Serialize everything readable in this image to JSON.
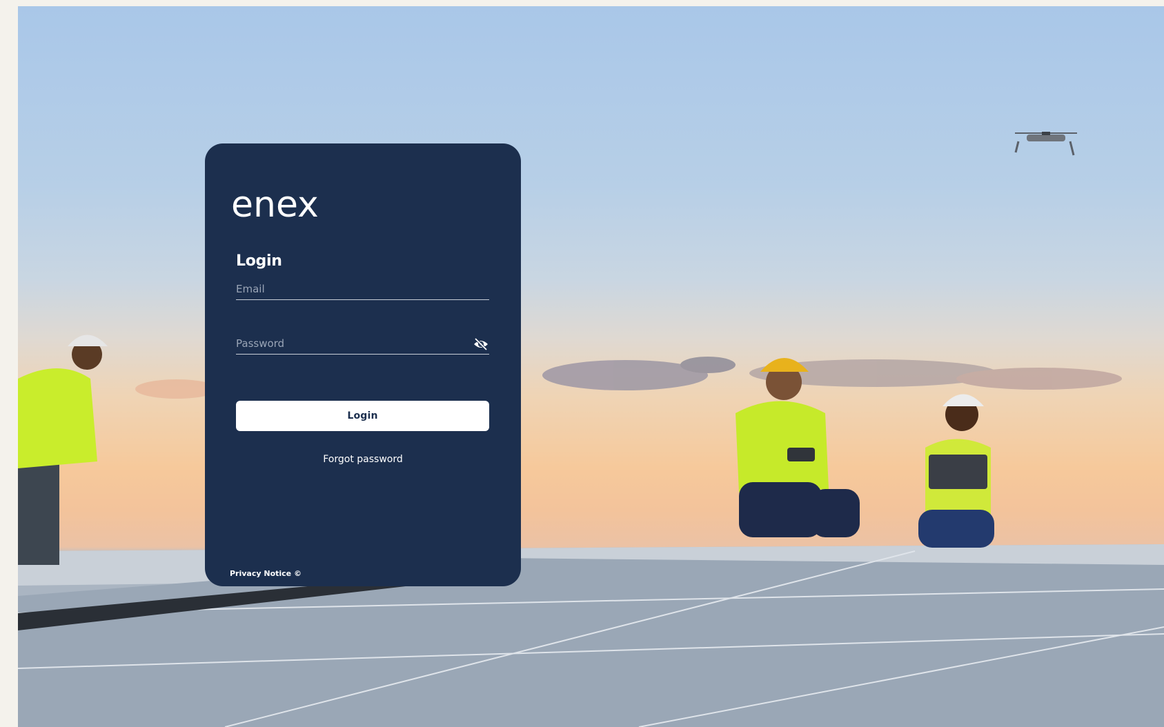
{
  "brand": {
    "logo_text": "enex"
  },
  "login_card": {
    "title": "Login",
    "email_placeholder": "Email",
    "password_placeholder": "Password",
    "login_button_label": "Login",
    "forgot_password_label": "Forgot password",
    "privacy_notice_label": "Privacy Notice ©"
  },
  "colors": {
    "card_background": "#1c2f4e",
    "button_background": "#ffffff",
    "text_primary": "#ffffff"
  },
  "icons": {
    "password_toggle": "eye-off-icon"
  }
}
